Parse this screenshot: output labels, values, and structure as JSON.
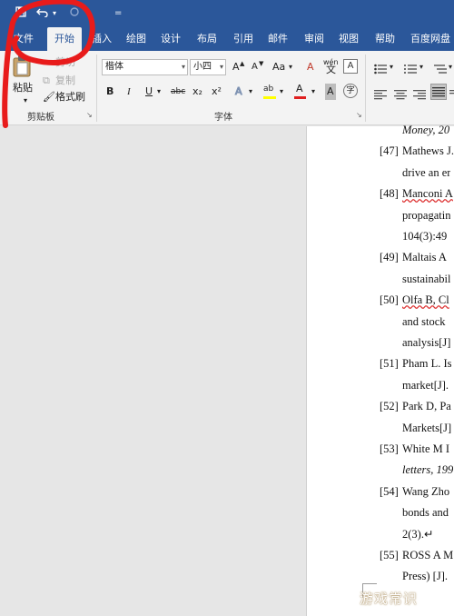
{
  "quick_access": {
    "more_glyph": "="
  },
  "tabs": [
    {
      "label": "文件"
    },
    {
      "label": "开始"
    },
    {
      "label": "插入"
    },
    {
      "label": "绘图"
    },
    {
      "label": "设计"
    },
    {
      "label": "布局"
    },
    {
      "label": "引用"
    },
    {
      "label": "邮件"
    },
    {
      "label": "审阅"
    },
    {
      "label": "视图"
    },
    {
      "label": "帮助"
    },
    {
      "label": "百度网盘"
    }
  ],
  "clipboard": {
    "paste_label": "粘贴",
    "cut_label": "剪切",
    "copy_label": "复制",
    "format_painter_label": "格式刷",
    "group_label": "剪贴板"
  },
  "font": {
    "font_name": "楷体",
    "font_size": "小四",
    "grow": "A",
    "shrink": "A",
    "case": "Aa",
    "clear": "A",
    "phonetic": "wén",
    "border_char": "A",
    "bold": "B",
    "italic": "I",
    "underline": "U",
    "strike": "abc",
    "subscript": "x₂",
    "superscript": "x²",
    "text_effect": "A",
    "highlight": "ab",
    "font_color": "A",
    "char_shading": "A",
    "enclose": "字",
    "group_label": "字体"
  },
  "colors": {
    "brand": "#2b579a",
    "ribbon": "#f3f3f3",
    "highlight": "#ffff00",
    "font_color": "#e02020",
    "annotation": "#e81b1b"
  },
  "references": [
    {
      "num": "",
      "text": "Money, 20",
      "italic": true
    },
    {
      "num": "[47]",
      "text": "Mathews J."
    },
    {
      "num": "",
      "text": "drive an er"
    },
    {
      "num": "[48]",
      "text": "Manconi A",
      "squiggle": true
    },
    {
      "num": "",
      "text": "propagatin"
    },
    {
      "num": "",
      "text": "104(3):49"
    },
    {
      "num": "[49]",
      "text": "Maltais A"
    },
    {
      "num": "",
      "text": "sustainabil"
    },
    {
      "num": "[50]",
      "text": "Olfa B, Cl",
      "squiggle": true
    },
    {
      "num": "",
      "text": "and stock"
    },
    {
      "num": "",
      "text": "analysis[J]"
    },
    {
      "num": "[51]",
      "text": "Pham L. Is"
    },
    {
      "num": "",
      "text": "market[J]."
    },
    {
      "num": "[52]",
      "text": "Park D, Pa"
    },
    {
      "num": "",
      "text": "Markets[J]"
    },
    {
      "num": "[53]",
      "text": "White M I"
    },
    {
      "num": "",
      "text": "letters, 199",
      "italic": true
    },
    {
      "num": "[54]",
      "text": "Wang Zho"
    },
    {
      "num": "",
      "text": "bonds and"
    },
    {
      "num": "",
      "text": "2(3).↵"
    },
    {
      "num": "[55]",
      "text": "ROSS A M"
    },
    {
      "num": "",
      "text": "Press) [J]."
    }
  ],
  "watermark": "游戏常识"
}
